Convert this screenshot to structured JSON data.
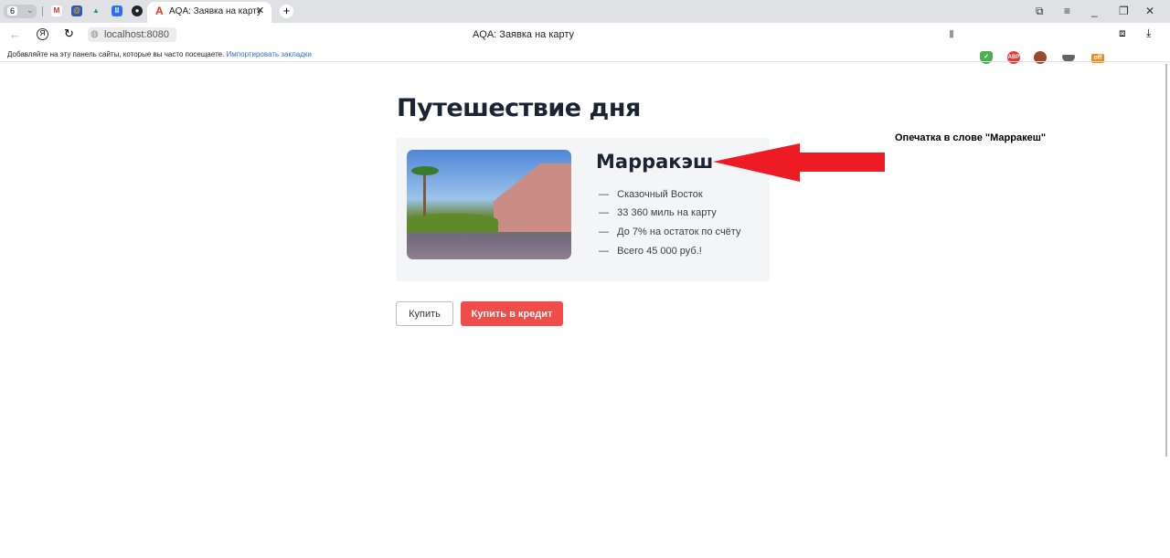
{
  "browser": {
    "tab_count": "6",
    "active_tab_title": "AQA: Заявка на карту",
    "page_title": "AQA: Заявка на карту",
    "address": "localhost:8080",
    "bookmarks_hint": "Добавляйте на эту панель сайты, которые вы часто посещаете.",
    "import_bookmarks": "Импортировать закладки",
    "extensions": [
      "adguard-icon",
      "adblock-plus-icon",
      "extension-icon",
      "extension-icon",
      "extension-off-icon"
    ],
    "ext_abp": "ABP",
    "ext_off": "off"
  },
  "page": {
    "heading": "Путешествие дня",
    "card": {
      "city": "Марракэш",
      "features": [
        "Сказочный Восток",
        "33 360 миль на карту",
        "До 7% на остаток по счёту",
        "Всего 45 000 руб.!"
      ]
    },
    "buy_label": "Купить",
    "credit_label": "Купить в кредит"
  },
  "annotation": {
    "text": "Опечатка в слове \"Марракеш\"",
    "color": "#ed1c24"
  },
  "colors": {
    "accent": "#ef4c4a",
    "heading": "#1b2433"
  }
}
